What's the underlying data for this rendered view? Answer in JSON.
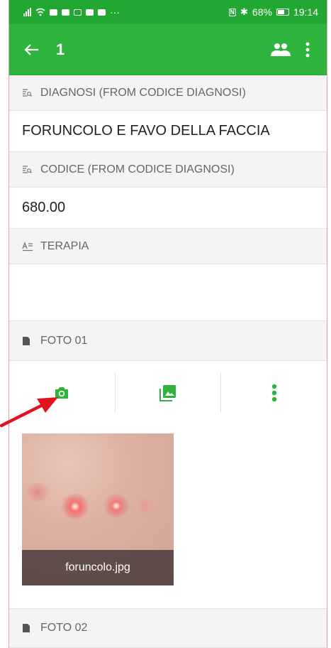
{
  "statusbar": {
    "battery": "68%",
    "time": "19:14",
    "dots": "···"
  },
  "toolbar": {
    "title": "1"
  },
  "fields": {
    "diagnosi_label": "DIAGNOSI (FROM CODICE DIAGNOSI)",
    "diagnosi_value": "FORUNCOLO E FAVO DELLA FACCIA",
    "codice_label": "CODICE (FROM CODICE DIAGNOSI)",
    "codice_value": "680.00",
    "terapia_label": "TERAPIA",
    "foto01_label": "FOTO 01",
    "foto02_label": "FOTO 02"
  },
  "photo": {
    "filename": "foruncolo.jpg"
  },
  "colors": {
    "accent": "#2eb33d",
    "statusbar": "#22a832",
    "annotation_arrow": "#e0141e"
  }
}
